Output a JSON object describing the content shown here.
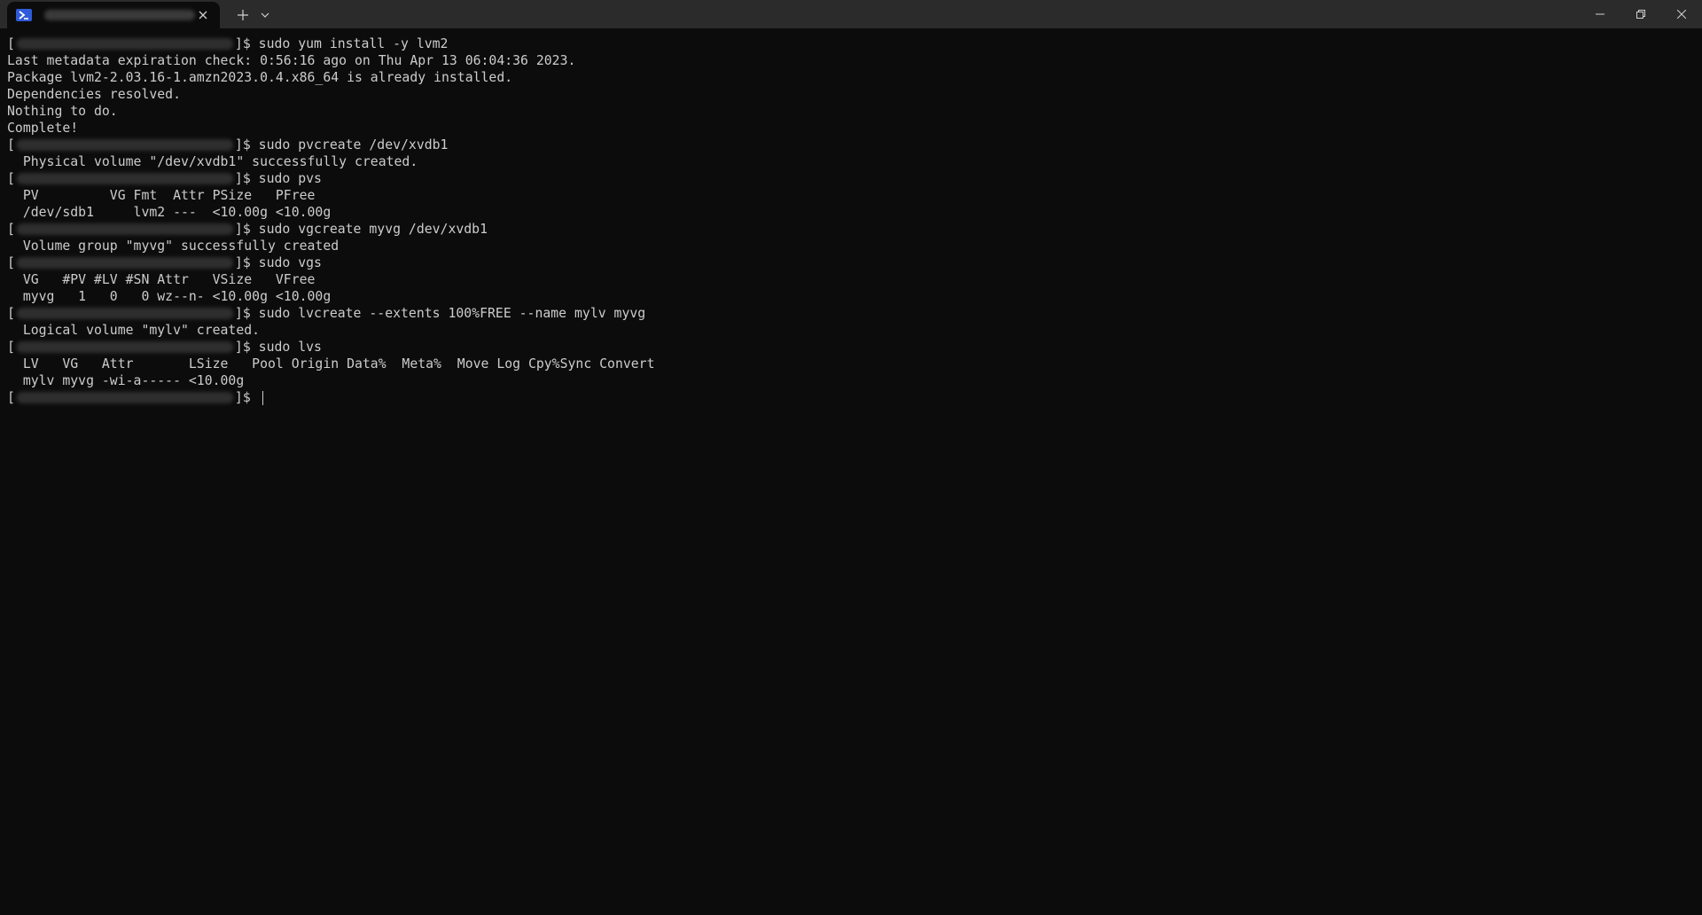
{
  "window": {
    "tab_title": "",
    "icons": {
      "tab_icon": "powershell-icon",
      "close_tab": "close-icon",
      "new_tab": "plus-icon",
      "dropdown": "chevron-down-icon",
      "minimize": "minimize-icon",
      "maximize": "restore-icon",
      "close_window": "close-icon"
    }
  },
  "terminal": {
    "prompt_open": "[",
    "prompt_close": "]$",
    "lines": [
      {
        "type": "prompt",
        "text": " sudo yum install -y lvm2"
      },
      {
        "type": "output",
        "text": "Last metadata expiration check: 0:56:16 ago on Thu Apr 13 06:04:36 2023."
      },
      {
        "type": "output",
        "text": "Package lvm2-2.03.16-1.amzn2023.0.4.x86_64 is already installed."
      },
      {
        "type": "output",
        "text": "Dependencies resolved."
      },
      {
        "type": "output",
        "text": "Nothing to do."
      },
      {
        "type": "output",
        "text": "Complete!"
      },
      {
        "type": "prompt",
        "text": " sudo pvcreate /dev/xvdb1"
      },
      {
        "type": "output",
        "text": "  Physical volume \"/dev/xvdb1\" successfully created."
      },
      {
        "type": "prompt",
        "text": " sudo pvs"
      },
      {
        "type": "output",
        "text": "  PV         VG Fmt  Attr PSize   PFree"
      },
      {
        "type": "output",
        "text": "  /dev/sdb1     lvm2 ---  <10.00g <10.00g"
      },
      {
        "type": "prompt",
        "text": " sudo vgcreate myvg /dev/xvdb1"
      },
      {
        "type": "output",
        "text": "  Volume group \"myvg\" successfully created"
      },
      {
        "type": "prompt",
        "text": " sudo vgs"
      },
      {
        "type": "output",
        "text": "  VG   #PV #LV #SN Attr   VSize   VFree"
      },
      {
        "type": "output",
        "text": "  myvg   1   0   0 wz--n- <10.00g <10.00g"
      },
      {
        "type": "prompt",
        "text": " sudo lvcreate --extents 100%FREE --name mylv myvg"
      },
      {
        "type": "output",
        "text": "  Logical volume \"mylv\" created."
      },
      {
        "type": "prompt",
        "text": " sudo lvs"
      },
      {
        "type": "output",
        "text": "  LV   VG   Attr       LSize   Pool Origin Data%  Meta%  Move Log Cpy%Sync Convert"
      },
      {
        "type": "output",
        "text": "  mylv myvg -wi-a----- <10.00g"
      },
      {
        "type": "prompt_cursor",
        "text": " "
      }
    ]
  }
}
